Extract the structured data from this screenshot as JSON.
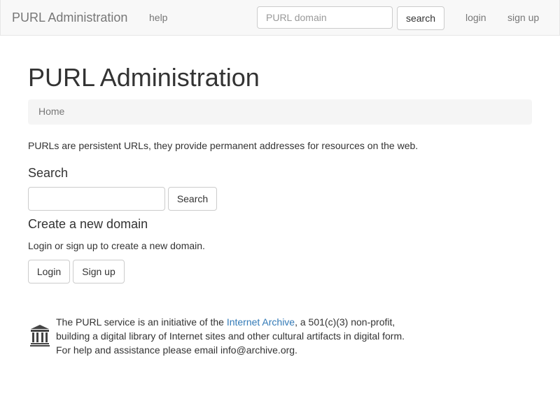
{
  "navbar": {
    "brand": "PURL Administration",
    "help_label": "help",
    "search_placeholder": "PURL domain",
    "search_button": "search",
    "login_label": "login",
    "signup_label": "sign up"
  },
  "main": {
    "title": "PURL Administration",
    "breadcrumb": "Home",
    "intro": "PURLs are persistent URLs, they provide permanent addresses for resources on the web.",
    "search": {
      "heading": "Search",
      "input_value": "",
      "button_label": "Search"
    },
    "create": {
      "heading": "Create a new domain",
      "text": "Login or sign up to create a new domain.",
      "login_button": "Login",
      "signup_button": "Sign up"
    }
  },
  "footer": {
    "icon": "archive-building-icon",
    "line1_prefix": "The PURL service is an initiative of the ",
    "link_text": "Internet Archive",
    "line1_suffix": ", a 501(c)(3) non-profit,",
    "line2": "building a digital library of Internet sites and other cultural artifacts in digital form.",
    "line3": "For help and assistance please email info@archive.org."
  },
  "colors": {
    "navbar_bg": "#f8f8f8",
    "link": "#337ab7",
    "muted": "#777777",
    "text": "#333333"
  }
}
